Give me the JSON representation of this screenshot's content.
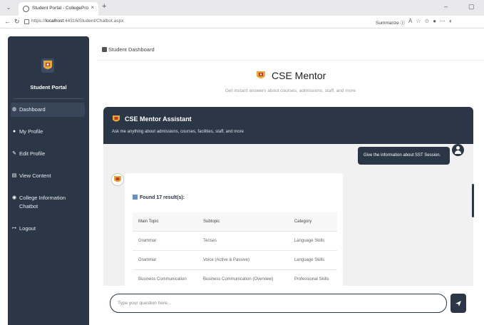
{
  "browser": {
    "tab_title": "Student Portal - CollegePro",
    "url_prefix": "https://",
    "url_host": "localhost",
    "url_rest": ":44316/Student/Chatbot.aspx",
    "summarize_label": "Summarize",
    "tab_close": "×",
    "new_tab": "+",
    "minimize": "–",
    "maximize": "▢"
  },
  "sidebar": {
    "title": "Student Portal",
    "items": [
      {
        "label": "Dashboard",
        "icon": "dashboard-icon",
        "active": true
      },
      {
        "label": "My Profile",
        "icon": "user-icon",
        "active": false
      },
      {
        "label": "Edit Profile",
        "icon": "edit-icon",
        "active": false
      },
      {
        "label": "View Content",
        "icon": "content-icon",
        "active": false
      },
      {
        "label": "College Information Chatbot",
        "icon": "globe-icon",
        "active": false
      },
      {
        "label": "Logout",
        "icon": "logout-icon",
        "active": false
      }
    ]
  },
  "breadcrumb": "Student Dashboard",
  "page": {
    "title": "CSE Mentor",
    "subtitle": "Get instant answers about courses, admissions, staff, and more"
  },
  "chat": {
    "header_title": "CSE Mentor Assistant",
    "header_subtitle": "Ask me anything about admissions, courses, facilities, staff, and more",
    "user_message": "Give the information about SST Session.",
    "results_label": "Found 17 result(s):",
    "table": {
      "headers": [
        "Main Topic",
        "Subtopic",
        "Category"
      ],
      "rows": [
        [
          "Grammar",
          "Tenses",
          "Language Skills"
        ],
        [
          "Grammar",
          "Voice (Active & Passive)",
          "Language Skills"
        ],
        [
          "Business Communication",
          "Business Communication (Overview)",
          "Professional Skills"
        ]
      ]
    },
    "input_placeholder": "Type your question here..."
  },
  "colors": {
    "primary": "#2b3646",
    "chat_bg": "#f1f1f1"
  }
}
